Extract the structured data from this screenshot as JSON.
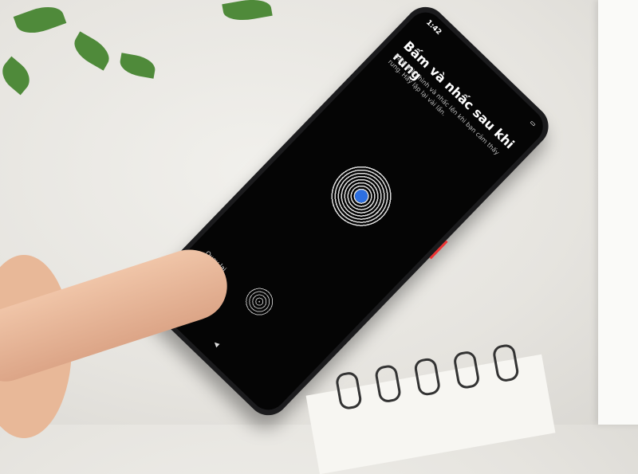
{
  "phone_screen": {
    "status_time": "1:42",
    "title": "Bấm và nhấc sau khi rung",
    "description": "Bấm màn hình và nhấc lên khi bạn cảm thấy rung. Hãy lặp lại vài lần.",
    "back_label": "Quay lại",
    "fingerprint_icon": "fingerprint-icon",
    "accent_color": "#2d6fe0"
  }
}
